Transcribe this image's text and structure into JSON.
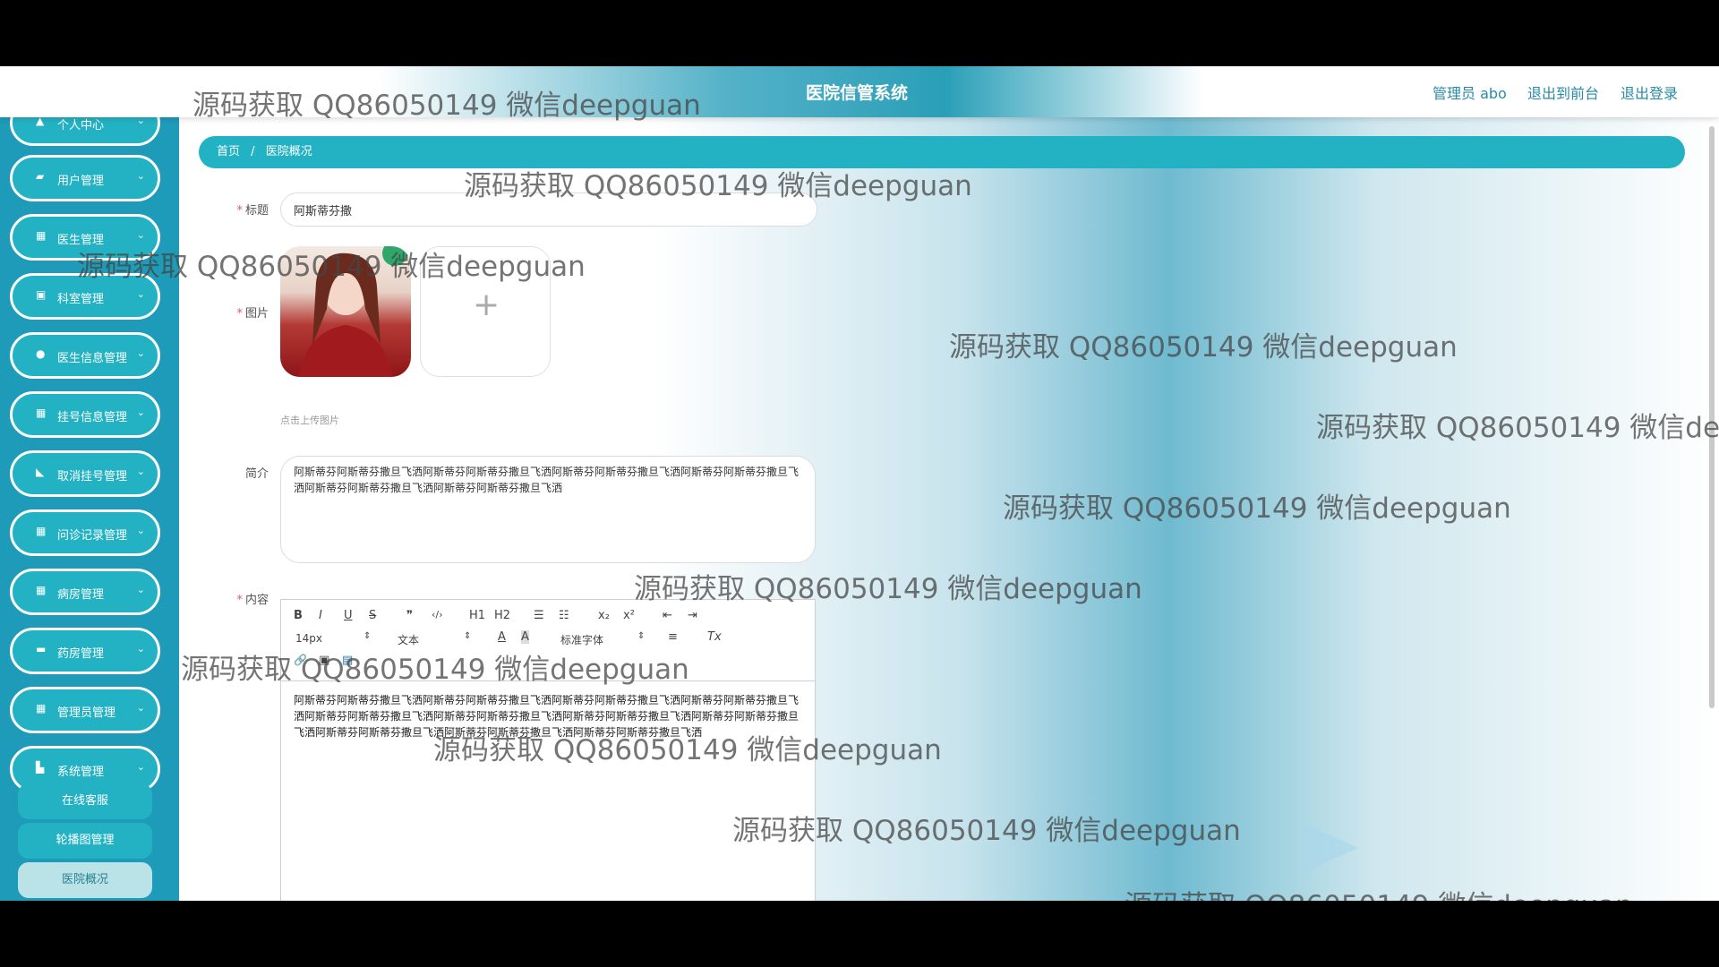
{
  "header": {
    "title": "医院信管系统",
    "user_label": "管理员 abo",
    "to_front_label": "退出到前台",
    "logout_label": "退出登录"
  },
  "sidebar": {
    "items": [
      {
        "label": "个人中心",
        "icon": "user-icon"
      },
      {
        "label": "用户管理",
        "icon": "user-group-icon"
      },
      {
        "label": "医生管理",
        "icon": "grid-icon"
      },
      {
        "label": "科室管理",
        "icon": "clipboard-icon"
      },
      {
        "label": "医生信息管理",
        "icon": "person-icon"
      },
      {
        "label": "挂号信息管理",
        "icon": "grid-icon"
      },
      {
        "label": "取消挂号管理",
        "icon": "thumb-icon"
      },
      {
        "label": "问诊记录管理",
        "icon": "grid-icon"
      },
      {
        "label": "病房管理",
        "icon": "grid-icon"
      },
      {
        "label": "药房管理",
        "icon": "car-icon"
      },
      {
        "label": "管理员管理",
        "icon": "grid-icon"
      },
      {
        "label": "系统管理",
        "icon": "building-icon"
      }
    ],
    "sub_items": [
      {
        "label": "在线客服"
      },
      {
        "label": "轮播图管理"
      },
      {
        "label": "医院概况"
      }
    ]
  },
  "breadcrumb": {
    "home": "首页",
    "sep": "/",
    "current": "医院概况"
  },
  "form": {
    "title_label": "标题",
    "title_value": "阿斯蒂芬撒",
    "image_label": "图片",
    "upload_hint": "点击上传图片",
    "intro_label": "简介",
    "intro_value": "阿斯蒂芬阿斯蒂芬撒旦飞洒阿斯蒂芬阿斯蒂芬撒旦飞洒阿斯蒂芬阿斯蒂芬撒旦飞洒阿斯蒂芬阿斯蒂芬撒旦飞洒阿斯蒂芬阿斯蒂芬撒旦飞洒阿斯蒂芬阿斯蒂芬撒旦飞洒",
    "content_label": "内容",
    "content_value": "阿斯蒂芬阿斯蒂芬撒旦飞洒阿斯蒂芬阿斯蒂芬撒旦飞洒阿斯蒂芬阿斯蒂芬撒旦飞洒阿斯蒂芬阿斯蒂芬撒旦飞洒阿斯蒂芬阿斯蒂芬撒旦飞洒阿斯蒂芬阿斯蒂芬撒旦飞洒阿斯蒂芬阿斯蒂芬撒旦飞洒阿斯蒂芬阿斯蒂芬撒旦飞洒阿斯蒂芬阿斯蒂芬撒旦飞洒阿斯蒂芬阿斯蒂芬撒旦飞洒阿斯蒂芬阿斯蒂芬撒旦飞洒"
  },
  "editor_toolbar": {
    "bold": "B",
    "italic": "I",
    "underline": "U",
    "strike": "S",
    "quote": "❞",
    "code": "‹/›",
    "h1": "H1",
    "h2": "H2",
    "ol": "☰",
    "ul": "☷",
    "sub": "x₂",
    "sup": "x²",
    "outdent": "⇤",
    "indent": "⇥",
    "size": "14px",
    "text_type": "文本",
    "font_color": "A",
    "bg_color": "A",
    "font_family": "标准字体",
    "align": "≡",
    "clear": "Tx",
    "link": "🔗",
    "image": "▣",
    "video": "▤"
  },
  "watermark": "源码获取 QQ86050149 微信deepguan",
  "colors": {
    "accent": "#23b2c3",
    "sidebar": "#1e9bb8",
    "required": "#e05a5a"
  }
}
